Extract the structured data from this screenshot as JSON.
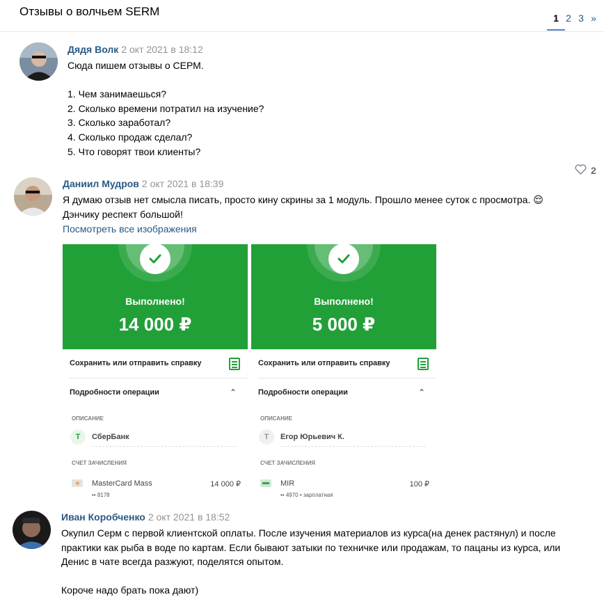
{
  "header": {
    "title": "Отзывы о волчьем SERM",
    "pages": [
      "1",
      "2",
      "3"
    ],
    "next": "»"
  },
  "posts": [
    {
      "author": "Дядя Волк",
      "date": "2 окт 2021 в 18:12",
      "lines": [
        "Сюда пишем отзывы о СЕРМ.",
        "",
        "1. Чем занимаешься?",
        "2. Сколько времени потратил на изучение?",
        "3. Сколько заработал?",
        "4. Сколько продаж сделал?",
        "5. Что говорят твои клиенты?"
      ],
      "likes": "2"
    },
    {
      "author": "Даниил Мудров",
      "date": "2 окт 2021 в 18:39",
      "lines": [
        "Я думаю отзыв нет смысла писать, просто кину скрины за 1 модуль. Прошло менее суток с просмотра. 😌",
        "Дэнчику респект большой!"
      ],
      "view_all": "Посмотреть все изображения",
      "receipts": [
        {
          "status": "Выполнено!",
          "amount": "14 000 ₽",
          "save": "Сохранить или отправить справку",
          "details": "Подробности операции",
          "desc_label": "ОПИСАНИЕ",
          "initial": "Т",
          "payee": "СберБанк",
          "account_label": "СЧЕТ ЗАЧИСЛЕНИЯ",
          "card_name": "MasterCard Mass",
          "card_sum": "14 000 ₽",
          "card_sub": "•• 8178"
        },
        {
          "status": "Выполнено!",
          "amount": "5 000 ₽",
          "save": "Сохранить или отправить справку",
          "details": "Подробности операции",
          "desc_label": "ОПИСАНИЕ",
          "initial": "Т",
          "payee": "Егор Юрьевич К.",
          "account_label": "СЧЕТ ЗАЧИСЛЕНИЯ",
          "card_name": "MIR",
          "card_sum": "100 ₽",
          "card_sub": "•• 4970 • зарплатная"
        }
      ]
    },
    {
      "author": "Иван Коробченко",
      "date": "2 окт 2021 в 18:52",
      "lines": [
        "Окупил Серм с первой клиентской оплаты. После изучения материалов из курса(на денек растянул) и после",
        "практики как рыба в воде по картам. Если бывают затыки по техничке или продажам, то пацаны из курса, или",
        "Денис в чате всегда разжуют, поделятся опытом.",
        "",
        "Короче надо брать пока дают)"
      ]
    }
  ],
  "colors": {
    "link": "#2a5885",
    "date": "#939393",
    "sber_green": "#21a038"
  }
}
